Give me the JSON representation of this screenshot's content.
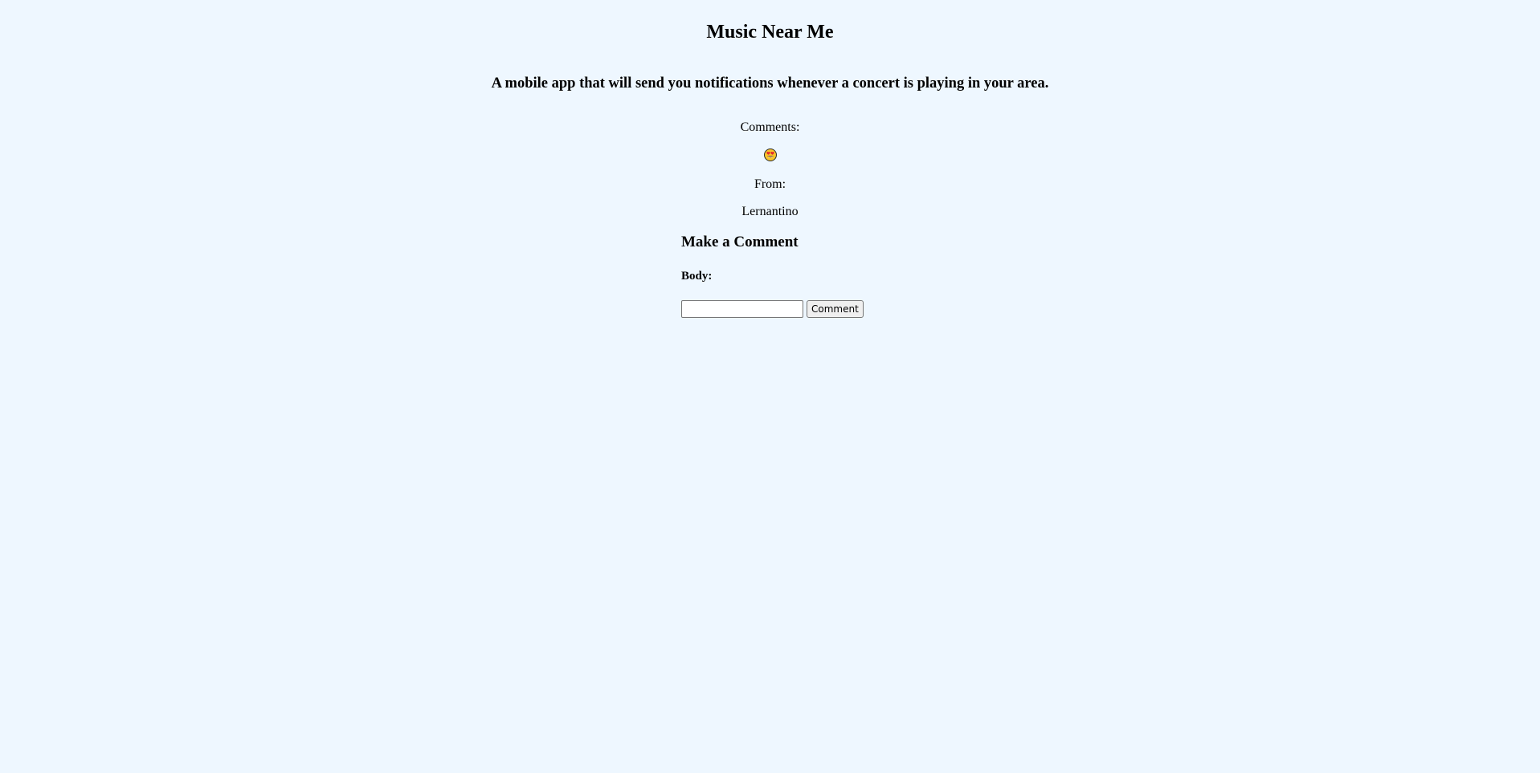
{
  "page": {
    "title": "Music Near Me",
    "description": "A mobile app that will send you notifications whenever a concert is playing in your area."
  },
  "comments": {
    "label": "Comments:",
    "items": [
      {
        "emoji_icon": "heart-eyes-emoji-icon",
        "from_label": "From:",
        "author": "Lernantino"
      }
    ]
  },
  "comment_form": {
    "heading": "Make a Comment",
    "body_label": "Body:",
    "body_value": "",
    "submit_label": "Comment"
  },
  "colors": {
    "background": "#eef7ff",
    "emoji_face": "#f7c52b",
    "emoji_hearts": "#e3262d"
  }
}
